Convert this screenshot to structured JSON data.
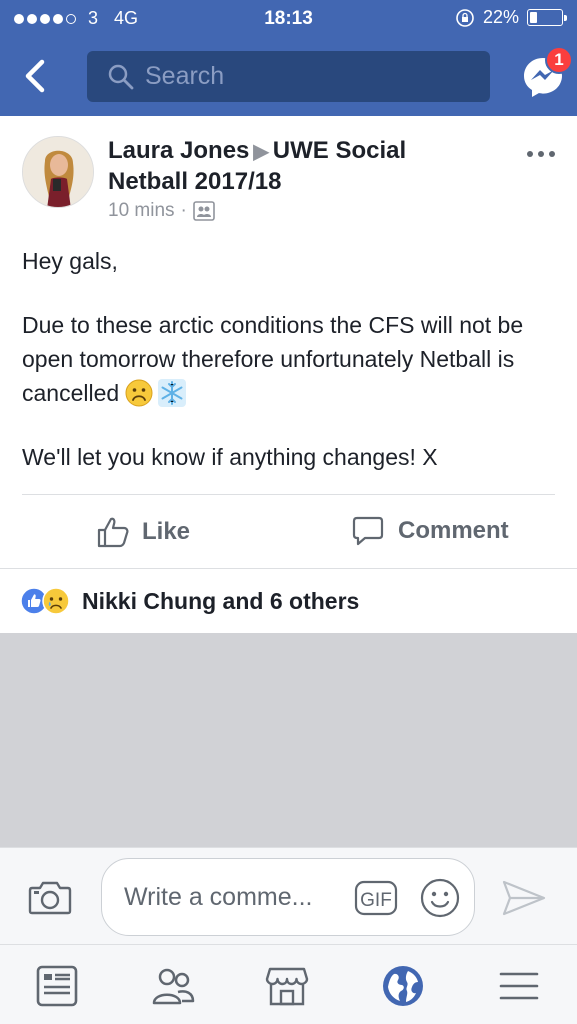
{
  "status_bar": {
    "carrier": "3",
    "network": "4G",
    "time": "18:13",
    "battery": "22%",
    "battery_level": 0.22,
    "signal_bars_filled": 4,
    "signal_bars_total": 5
  },
  "nav": {
    "search_placeholder": "Search",
    "messenger_badge": "1"
  },
  "post": {
    "author": "Laura Jones",
    "group": "UWE Social Netball 2017/18",
    "time": "10 mins",
    "separator": "·",
    "body": {
      "greeting": "Hey gals,",
      "line1": "Due to these arctic conditions the CFS will not be open tomorrow therefore unfortunately Netball is cancelled",
      "closing": "We'll let you know if anything changes! X"
    },
    "actions": {
      "like": "Like",
      "comment": "Comment"
    },
    "reactions_summary": "Nikki Chung and 6 others"
  },
  "composer": {
    "placeholder": "Write a comme...",
    "gif_label": "GIF"
  },
  "colors": {
    "brand_blue": "#4267b2",
    "search_bg": "#29487d",
    "badge_red": "#fa3e3e",
    "active_tab": "#4267b2",
    "inactive_icon": "#606770"
  },
  "icons": [
    "back-icon",
    "search-icon",
    "messenger-icon",
    "more-icon",
    "group-icon",
    "like-icon",
    "comment-icon",
    "camera-icon",
    "gif-icon",
    "emoji-icon",
    "send-icon",
    "news-feed-icon",
    "friends-icon",
    "marketplace-icon",
    "notifications-globe-icon",
    "menu-icon"
  ]
}
